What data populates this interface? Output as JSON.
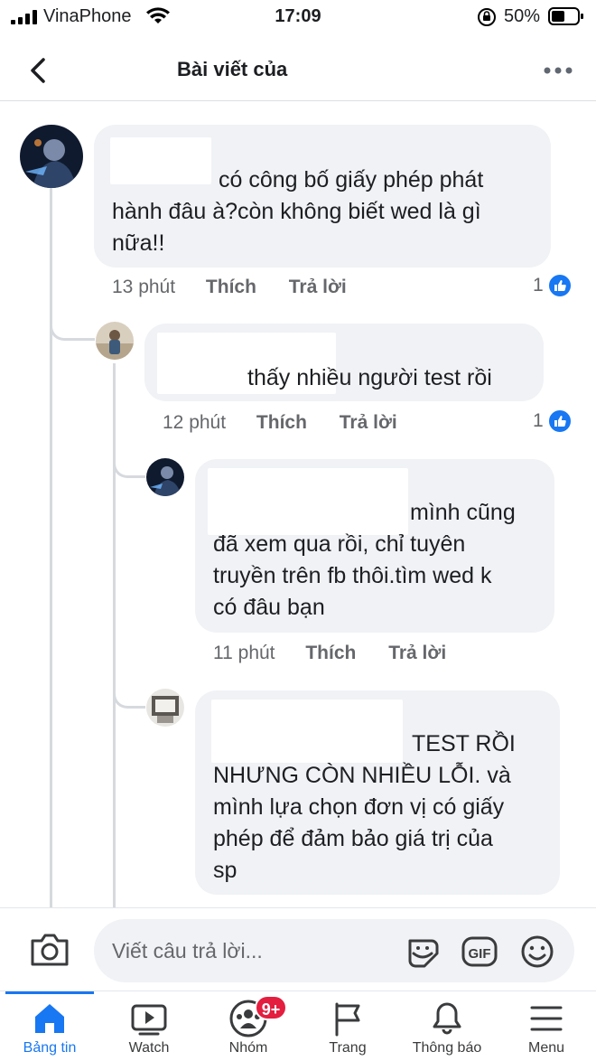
{
  "status_bar": {
    "carrier": "VinaPhone",
    "time": "17:09",
    "battery": "50%"
  },
  "header": {
    "title": "Bài viết của"
  },
  "comments": [
    {
      "text": "có công bố giấy phép phát\nhành đâu à?còn không biết wed là gì\nnữa!!",
      "time": "13 phút",
      "like_label": "Thích",
      "reply_label": "Trả lời",
      "reactions": "1"
    },
    {
      "text": "thấy nhiều người test rồi",
      "time": "12 phút",
      "like_label": "Thích",
      "reply_label": "Trả lời",
      "reactions": "1"
    },
    {
      "text": "mình cũng\nđã xem qua rồi, chỉ tuyên\ntruyền trên fb thôi.tìm wed k\ncó đâu bạn",
      "time": "11 phút",
      "like_label": "Thích",
      "reply_label": "Trả lời"
    },
    {
      "text": "TEST RỒI\nNHƯNG CÒN NHIỀU LỖI. và\nmình lựa chọn đơn vị có giấy\nphép để đảm bảo giá trị của\nsp"
    }
  ],
  "composer": {
    "placeholder": "Viết câu trả lời..."
  },
  "tabs": [
    {
      "label": "Bảng tin",
      "active": true
    },
    {
      "label": "Watch"
    },
    {
      "label": "Nhóm",
      "badge": "9+"
    },
    {
      "label": "Trang"
    },
    {
      "label": "Thông báo"
    },
    {
      "label": "Menu"
    }
  ],
  "colors": {
    "accent": "#1877f2",
    "bubble": "#f0f2f5",
    "meta_text": "#65676b",
    "badge": "#e41e3f"
  }
}
